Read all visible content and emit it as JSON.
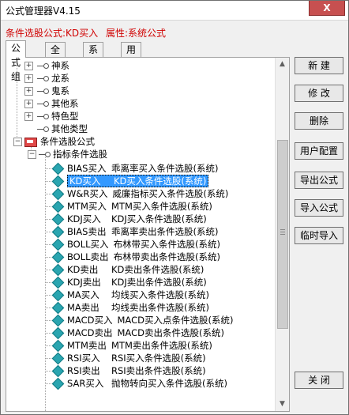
{
  "window": {
    "title": "公式管理器V4.15",
    "close_label": "X"
  },
  "subtitle": {
    "formula": "条件选股公式:KD买入",
    "attr": "属性:系统公式"
  },
  "tabs": [
    {
      "label": "公式组",
      "active": true
    },
    {
      "label": "全部",
      "active": false
    },
    {
      "label": "系统",
      "active": false
    },
    {
      "label": "用户",
      "active": false
    }
  ],
  "tree": {
    "groups": [
      {
        "label": "神系"
      },
      {
        "label": "龙系"
      },
      {
        "label": "鬼系"
      },
      {
        "label": "其他系"
      },
      {
        "label": "特色型"
      },
      {
        "label": "其他类型"
      }
    ],
    "category": "条件选股公式",
    "subcategory": "指标条件选股",
    "items": [
      {
        "code": "BIAS买入",
        "desc": "乖离率买入条件选股(系统)"
      },
      {
        "code": "KD买入",
        "desc": "KD买入条件选股(系统)",
        "selected": true
      },
      {
        "code": "W&R买入",
        "desc": "威廉指标买入条件选股(系统)"
      },
      {
        "code": "MTM买入",
        "desc": "MTM买入条件选股(系统)"
      },
      {
        "code": "KDJ买入",
        "desc": "KDJ买入条件选股(系统)"
      },
      {
        "code": "BIAS卖出",
        "desc": "乖离率卖出条件选股(系统)"
      },
      {
        "code": "BOLL买入",
        "desc": "布林带买入条件选股(系统)"
      },
      {
        "code": "BOLL卖出",
        "desc": "布林带卖出条件选股(系统)"
      },
      {
        "code": "KD卖出",
        "desc": "KD卖出条件选股(系统)"
      },
      {
        "code": "KDJ卖出",
        "desc": "KDJ卖出条件选股(系统)"
      },
      {
        "code": "MA买入",
        "desc": "均线买入条件选股(系统)"
      },
      {
        "code": "MA卖出",
        "desc": "均线卖出条件选股(系统)"
      },
      {
        "code": "MACD买入",
        "desc": "MACD买入点条件选股(系统)"
      },
      {
        "code": "MACD卖出",
        "desc": "MACD卖出条件选股(系统)"
      },
      {
        "code": "MTM卖出",
        "desc": "MTM卖出条件选股(系统)"
      },
      {
        "code": "RSI买入",
        "desc": "RSI买入条件选股(系统)"
      },
      {
        "code": "RSI卖出",
        "desc": "RSI卖出条件选股(系统)"
      },
      {
        "code": "SAR买入",
        "desc": "抛物转向买入条件选股(系统)"
      }
    ]
  },
  "buttons": {
    "new": "新 建",
    "edit": "修 改",
    "delete": "删除",
    "user_config": "用户配置",
    "export": "导出公式",
    "import": "导入公式",
    "temp_import": "临时导入",
    "close": "关 闭"
  }
}
